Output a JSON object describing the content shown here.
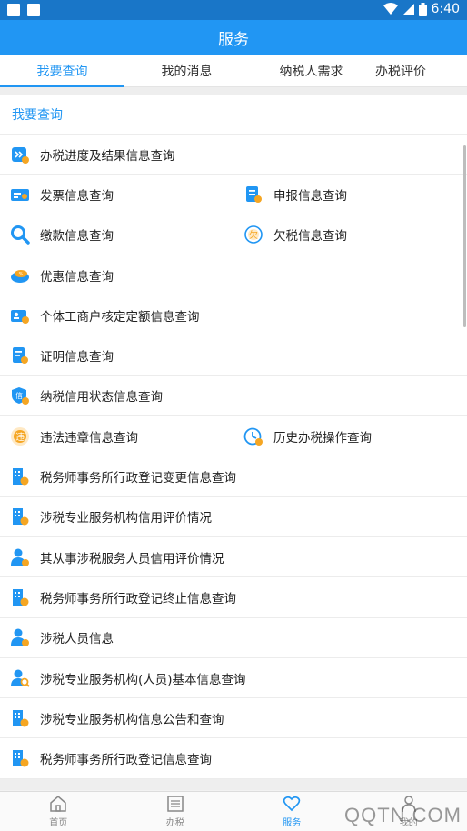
{
  "statusbar": {
    "time": "6:40"
  },
  "appbar": {
    "title": "服务"
  },
  "tabs": [
    {
      "label": "我要查询",
      "active": true
    },
    {
      "label": "我的消息",
      "active": false
    },
    {
      "label": "纳税人需求",
      "active": false
    },
    {
      "label": "办税评价",
      "active": false
    }
  ],
  "section": {
    "title": "我要查询"
  },
  "items": {
    "progress": "办税进度及结果信息查询",
    "invoice": "发票信息查询",
    "declare": "申报信息查询",
    "payment": "缴款信息查询",
    "arrears": "欠税信息查询",
    "preferential": "优惠信息查询",
    "individual": "个体工商户核定定额信息查询",
    "certificate": "证明信息查询",
    "credit": "纳税信用状态信息查询",
    "violation": "违法违章信息查询",
    "history": "历史办税操作查询",
    "firm_change": "税务师事务所行政登记变更信息查询",
    "agency_credit": "涉税专业服务机构信用评价情况",
    "staff_credit": "其从事涉税服务人员信用评价情况",
    "firm_end": "税务师事务所行政登记终止信息查询",
    "staff_info": "涉税人员信息",
    "agency_basic": "涉税专业服务机构(人员)基本信息查询",
    "agency_notice": "涉税专业服务机构信息公告和查询",
    "firm_reg": "税务师事务所行政登记信息查询"
  },
  "bottomnav": [
    {
      "label": "首页"
    },
    {
      "label": "办税"
    },
    {
      "label": "服务"
    },
    {
      "label": "我的"
    }
  ],
  "watermark": "QQTN.COM",
  "colors": {
    "primary": "#2196f3",
    "statusbar": "#1976c8",
    "icon_orange": "#f5a623"
  }
}
